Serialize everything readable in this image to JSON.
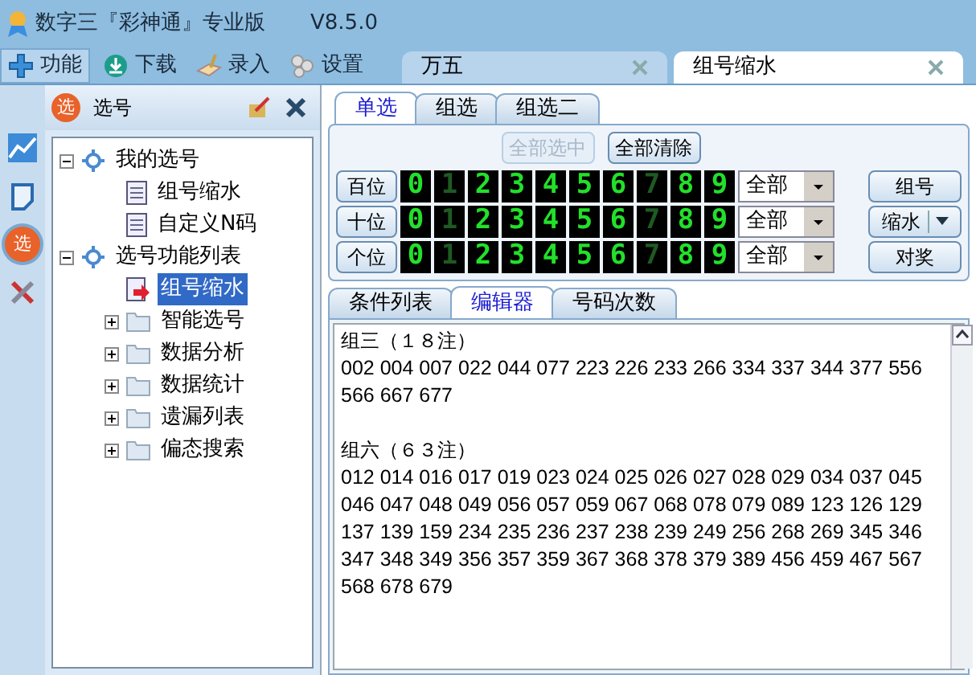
{
  "window": {
    "title": "数字三『彩神通』专业版",
    "version": "V8.5.0"
  },
  "toolbar": [
    {
      "label": "功能",
      "kind": "plus",
      "selected": true
    },
    {
      "label": "下载",
      "kind": "download",
      "selected": false
    },
    {
      "label": "录入",
      "kind": "entry",
      "selected": false
    },
    {
      "label": "设置",
      "kind": "gears",
      "selected": false
    }
  ],
  "doc_tabs": [
    {
      "label": "万五",
      "selected": false
    },
    {
      "label": "组号缩水",
      "selected": true
    }
  ],
  "side_icons": [
    {
      "kind": "chart",
      "selected": false
    },
    {
      "kind": "note",
      "selected": false
    },
    {
      "kind": "pick",
      "label": "选",
      "selected": true
    },
    {
      "kind": "tools",
      "selected": false
    }
  ],
  "panel": {
    "badge": "选",
    "title": "选号"
  },
  "tree": [
    {
      "label": "我的选号",
      "kind": "root",
      "expanded": true,
      "children": [
        {
          "label": "组号缩水",
          "kind": "doc",
          "selected": false
        },
        {
          "label": "自定义N码",
          "kind": "doc",
          "selected": false
        }
      ]
    },
    {
      "label": "选号功能列表",
      "kind": "root",
      "expanded": true,
      "children": [
        {
          "label": "组号缩水",
          "kind": "active",
          "selected": true
        },
        {
          "label": "智能选号",
          "kind": "folder",
          "expanded": false
        },
        {
          "label": "数据分析",
          "kind": "folder",
          "expanded": false
        },
        {
          "label": "数据统计",
          "kind": "folder",
          "expanded": false
        },
        {
          "label": "遗漏列表",
          "kind": "folder",
          "expanded": false
        },
        {
          "label": "偏态搜索",
          "kind": "folder",
          "expanded": false
        }
      ]
    }
  ],
  "select_tabs": [
    {
      "label": "单选",
      "selected": true
    },
    {
      "label": "组选",
      "selected": false
    },
    {
      "label": "组选二",
      "selected": false
    }
  ],
  "top_buttons": [
    {
      "label": "全部选中",
      "disabled": true
    },
    {
      "label": "全部清除",
      "disabled": false
    }
  ],
  "rows": [
    {
      "label": "百位",
      "filter": "全部",
      "digits": [
        {
          "d": "0",
          "on": true
        },
        {
          "d": "1",
          "on": false
        },
        {
          "d": "2",
          "on": true
        },
        {
          "d": "3",
          "on": true
        },
        {
          "d": "4",
          "on": true
        },
        {
          "d": "5",
          "on": true
        },
        {
          "d": "6",
          "on": true
        },
        {
          "d": "7",
          "on": false
        },
        {
          "d": "8",
          "on": true
        },
        {
          "d": "9",
          "on": true
        }
      ]
    },
    {
      "label": "十位",
      "filter": "全部",
      "digits": [
        {
          "d": "0",
          "on": true
        },
        {
          "d": "1",
          "on": false
        },
        {
          "d": "2",
          "on": true
        },
        {
          "d": "3",
          "on": true
        },
        {
          "d": "4",
          "on": true
        },
        {
          "d": "5",
          "on": true
        },
        {
          "d": "6",
          "on": true
        },
        {
          "d": "7",
          "on": false
        },
        {
          "d": "8",
          "on": true
        },
        {
          "d": "9",
          "on": true
        }
      ]
    },
    {
      "label": "个位",
      "filter": "全部",
      "digits": [
        {
          "d": "0",
          "on": true
        },
        {
          "d": "1",
          "on": false
        },
        {
          "d": "2",
          "on": true
        },
        {
          "d": "3",
          "on": true
        },
        {
          "d": "4",
          "on": true
        },
        {
          "d": "5",
          "on": true
        },
        {
          "d": "6",
          "on": true
        },
        {
          "d": "7",
          "on": false
        },
        {
          "d": "8",
          "on": true
        },
        {
          "d": "9",
          "on": true
        }
      ]
    }
  ],
  "side_buttons": [
    {
      "label": "组号",
      "kind": "plain"
    },
    {
      "label": "缩水",
      "kind": "split"
    },
    {
      "label": "对奖",
      "kind": "plain"
    }
  ],
  "result_tabs": [
    {
      "label": "条件列表",
      "selected": false
    },
    {
      "label": "编辑器",
      "selected": true
    },
    {
      "label": "号码次数",
      "selected": false
    }
  ],
  "editor": [
    {
      "title": "组三（１８注）",
      "numbers": "002 004 007 022 044 077 223 226 233 266 334 337 344 377 556 566 667 677"
    },
    {
      "title": "组六（６３注）",
      "numbers": "012 014 016 017 019 023 024 025 026 027 028 029 034 037 045 046 047 048 049 056 057 059 067 068 078 079 089 123 126 129 137 139 159 234 235 236 237 238 239 249 256 268 269 345 346 347 348 349 356 357 359 367 368 378 379 389 456 459 467 567 568 678 679"
    }
  ]
}
